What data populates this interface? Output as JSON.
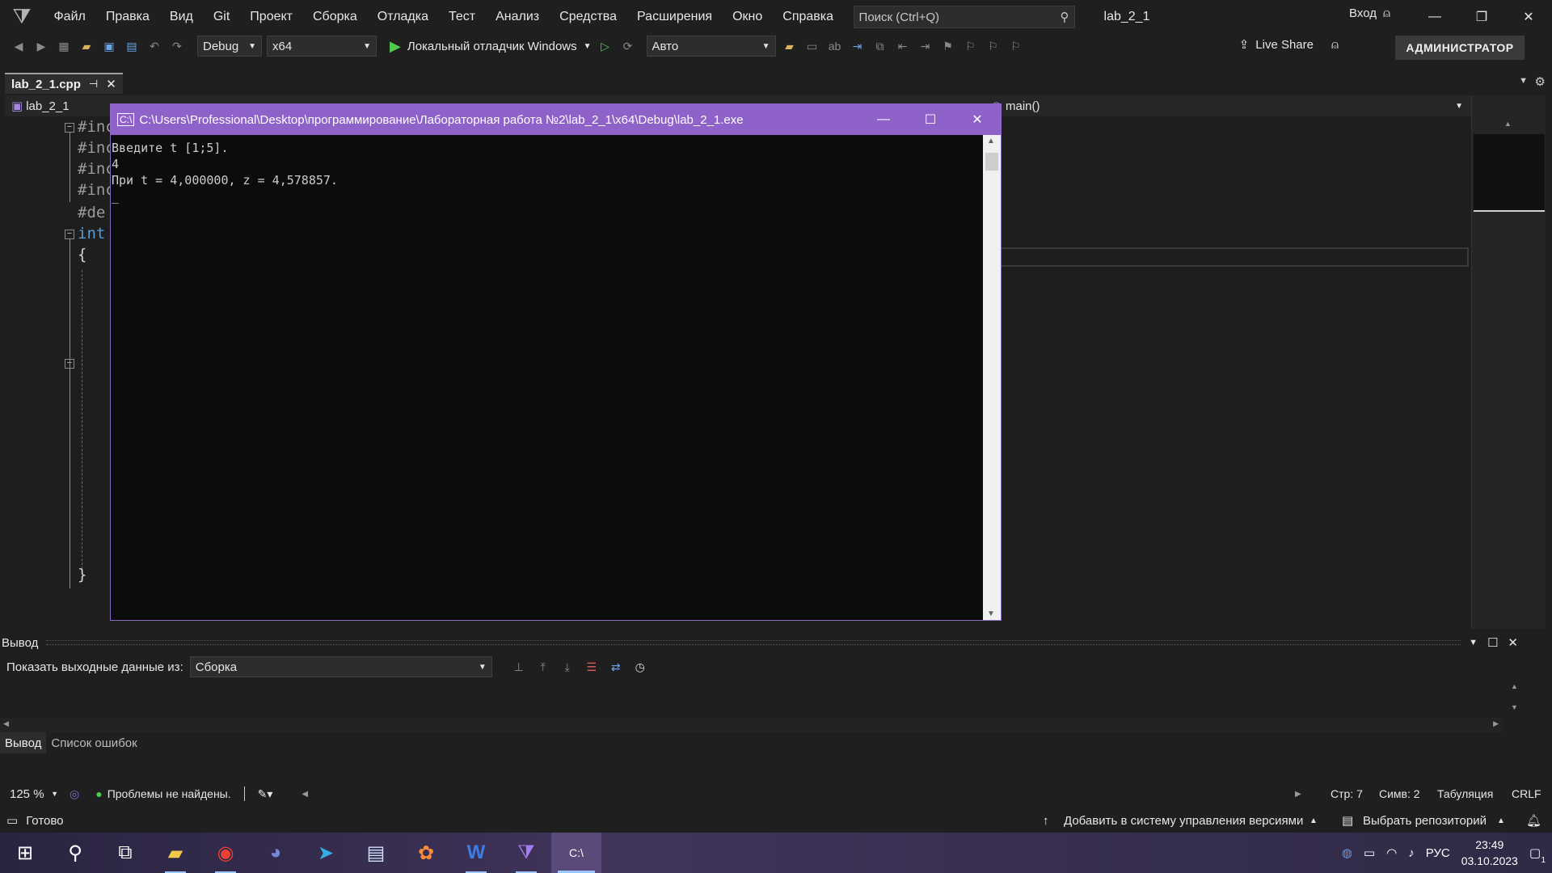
{
  "menubar": {
    "items": [
      "Файл",
      "Правка",
      "Вид",
      "Git",
      "Проект",
      "Сборка",
      "Отладка",
      "Тест",
      "Анализ",
      "Средства",
      "Расширения",
      "Окно",
      "Справка"
    ],
    "search_placeholder": "Поиск (Ctrl+Q)",
    "solution_title": "lab_2_1",
    "signin": "Вход"
  },
  "toolbar": {
    "config": "Debug",
    "platform": "x64",
    "run_label": "Локальный отладчик Windows",
    "mode": "Авто",
    "live_share": "Live Share",
    "admin": "АДМИНИСТРАТОР"
  },
  "document": {
    "tab_name": "lab_2_1.cpp",
    "nav_project": "lab_2_1",
    "nav_member": "main()"
  },
  "code": {
    "lines": [
      "#inc",
      "#inc",
      "#inc",
      "#inc",
      "#de",
      "int",
      "{",
      "}"
    ]
  },
  "console": {
    "title": "C:\\Users\\Professional\\Desktop\\программирование\\Лабораторная работа №2\\lab_2_1\\x64\\Debug\\lab_2_1.exe",
    "lines": [
      "Введите t [1;5].",
      "4",
      "При t = 4,000000, z = 4,578857.",
      "_"
    ]
  },
  "output_panel": {
    "title": "Вывод",
    "show_from_label": "Показать выходные данные из:",
    "source": "Сборка",
    "tabs": [
      "Вывод",
      "Список ошибок"
    ]
  },
  "editor_status": {
    "zoom": "125 %",
    "issues": "Проблемы не найдены.",
    "line": "Стр: 7",
    "col": "Симв: 2",
    "indent": "Табуляция",
    "eol": "CRLF"
  },
  "statusbar": {
    "ready": "Готово",
    "add_vcs": "Добавить в систему управления версиями",
    "choose_repo": "Выбрать репозиторий"
  },
  "taskbar": {
    "lang": "РУС",
    "time": "23:49",
    "date": "03.10.2023",
    "notifications": "1"
  }
}
